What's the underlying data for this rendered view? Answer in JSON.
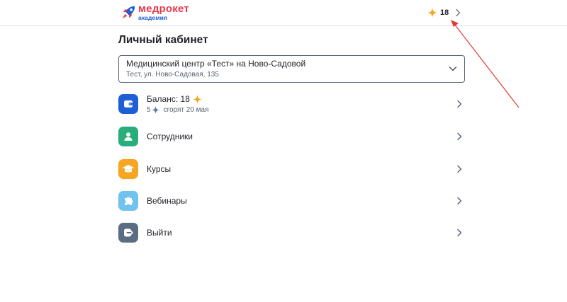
{
  "header": {
    "logo_main": "медрокет",
    "logo_sub": "академия",
    "balance_value": "18"
  },
  "page": {
    "title": "Личный кабинет"
  },
  "clinic_select": {
    "selected_name": "Медицинский центр «Тест» на Ново-Садовой",
    "selected_address": "Тест, ул. Ново-Садовая, 135"
  },
  "balance_item": {
    "label": "Баланс: 18",
    "expiring_count": "5",
    "expiring_text": "сгорят 20 мая"
  },
  "menu": [
    {
      "label": "Сотрудники",
      "icon": "user-icon",
      "color": "#27ae7a"
    },
    {
      "label": "Курсы",
      "icon": "graduation-cap-icon",
      "color": "#f6a623"
    },
    {
      "label": "Вебинары",
      "icon": "puzzle-icon",
      "color": "#6fc3ee"
    },
    {
      "label": "Выйти",
      "icon": "logout-icon",
      "color": "#5b6d82"
    }
  ],
  "colors": {
    "accent_blue": "#1e5fd6",
    "brand_red": "#e7374b",
    "star_orange": "#f6a623",
    "star_blue": "#5b77a8",
    "annotation_red": "#e53935"
  }
}
